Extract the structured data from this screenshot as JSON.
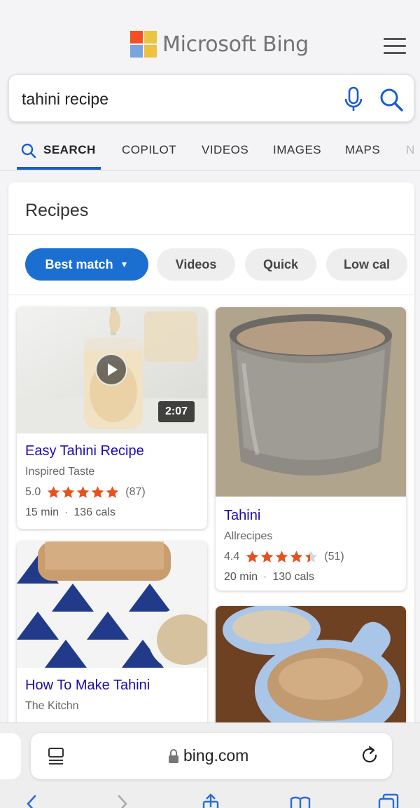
{
  "brand": {
    "name": "Microsoft Bing",
    "logo_colors": [
      "#f25022",
      "#e8c545",
      "#7aa3e0",
      "#f0c040"
    ]
  },
  "search": {
    "query": "tahini recipe",
    "accent_color": "#1a5bd4"
  },
  "tabs": [
    {
      "label": "SEARCH",
      "active": true
    },
    {
      "label": "COPILOT",
      "active": false
    },
    {
      "label": "VIDEOS",
      "active": false
    },
    {
      "label": "IMAGES",
      "active": false
    },
    {
      "label": "MAPS",
      "active": false
    },
    {
      "label": "N",
      "active": false
    }
  ],
  "recipes": {
    "title": "Recipes",
    "filters": [
      {
        "label": "Best match",
        "active": true
      },
      {
        "label": "Videos",
        "active": false
      },
      {
        "label": "Quick",
        "active": false
      },
      {
        "label": "Low cal",
        "active": false
      }
    ],
    "items": [
      {
        "title": "Easy Tahini Recipe",
        "source": "Inspired Taste",
        "rating": "5.0",
        "rating_value": 5.0,
        "reviews": "(87)",
        "time": "15 min",
        "calories": "136 cals",
        "video_duration": "2:07"
      },
      {
        "title": "Tahini",
        "source": "Allrecipes",
        "rating": "4.4",
        "rating_value": 4.4,
        "reviews": "(51)",
        "time": "20 min",
        "calories": "130 cals"
      },
      {
        "title": "How To Make Tahini",
        "source": "The Kitchn"
      }
    ],
    "star_color": "#e8501e"
  },
  "browser": {
    "url": "bing.com"
  }
}
